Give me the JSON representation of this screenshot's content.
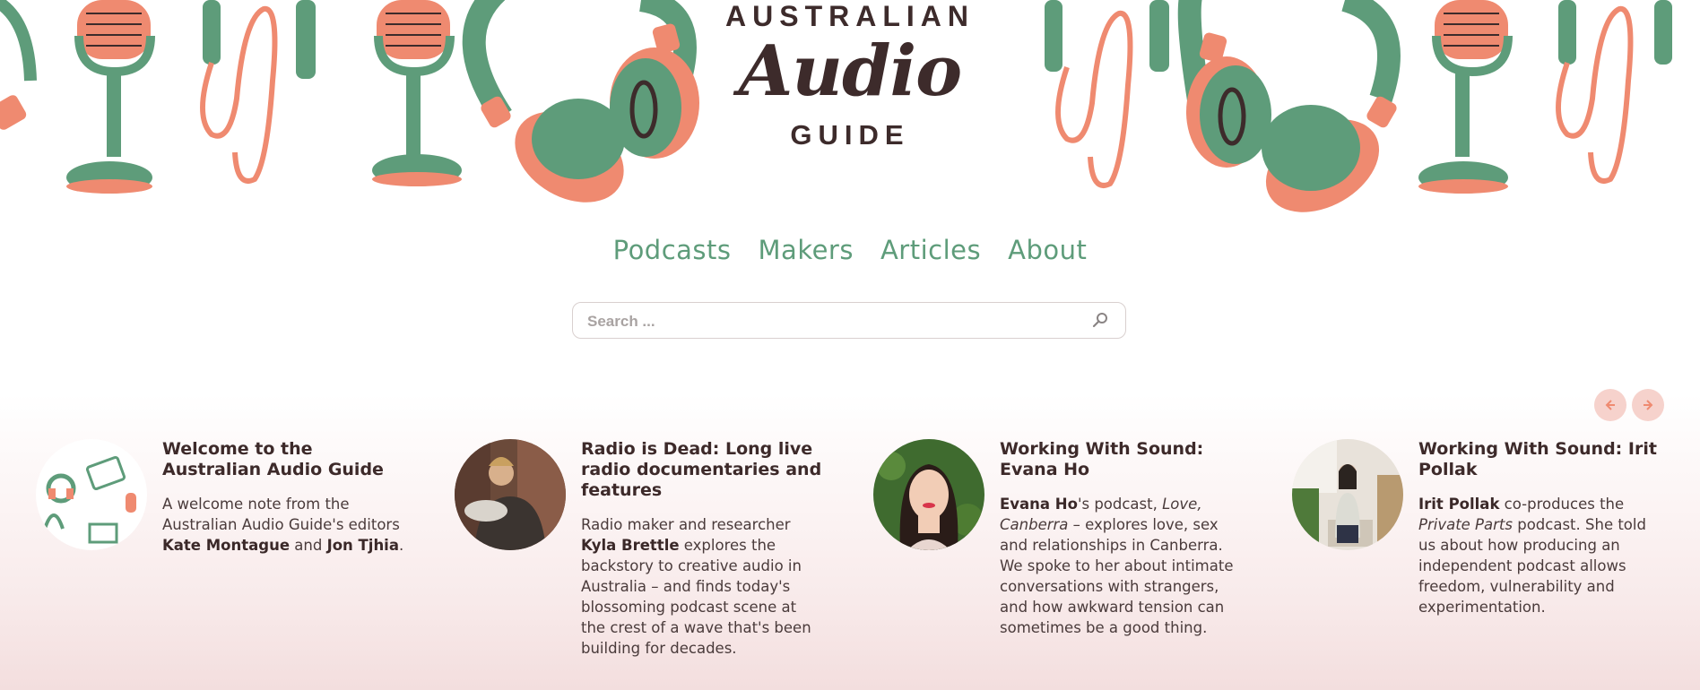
{
  "site": {
    "logo_line1": "AUSTRALIAN",
    "logo_line2": "Audio",
    "logo_line3": "GUIDE"
  },
  "nav": {
    "items": [
      "Podcasts",
      "Makers",
      "Articles",
      "About"
    ]
  },
  "search": {
    "placeholder": "Search ...",
    "value": ""
  },
  "icons": {
    "search": "search-icon",
    "prev": "arrow-left-icon",
    "next": "arrow-right-icon"
  },
  "colors": {
    "green": "#5e9c7a",
    "coral": "#ef8a70",
    "dark": "#3d2b2b",
    "arrow_bg": "#f6d2cc"
  },
  "cards": [
    {
      "title": "Welcome to the Australian Audio Guide",
      "t1": "A welcome note from the Australian Audio Guide's editors ",
      "b1": "Kate Montague",
      "t2": " and ",
      "b2": "Jon Tjhia",
      "t3": "."
    },
    {
      "title": "Radio is Dead: Long live radio documentaries and features",
      "t1": "Radio maker and researcher ",
      "b1": "Kyla Brettle",
      "t2": " explores the backstory to creative audio in Australia – and finds today's blossoming podcast scene at the crest of a wave that's been building for decades."
    },
    {
      "title": "Working With Sound: Evana Ho",
      "b1": "Evana Ho",
      "t1": "'s podcast, ",
      "i1": "Love, Canberra",
      "t2": " – explores love, sex and relationships in Canberra. We spoke to her about intimate conversations with strangers, and how awkward tension can sometimes be a good thing."
    },
    {
      "title": "Working With Sound: Irit Pollak",
      "b1": "Irit Pollak",
      "t1": " co-produces the ",
      "i1": "Private Parts",
      "t2": " podcast. She told us about how producing an independent podcast allows freedom, vulnerability and experimentation."
    }
  ]
}
